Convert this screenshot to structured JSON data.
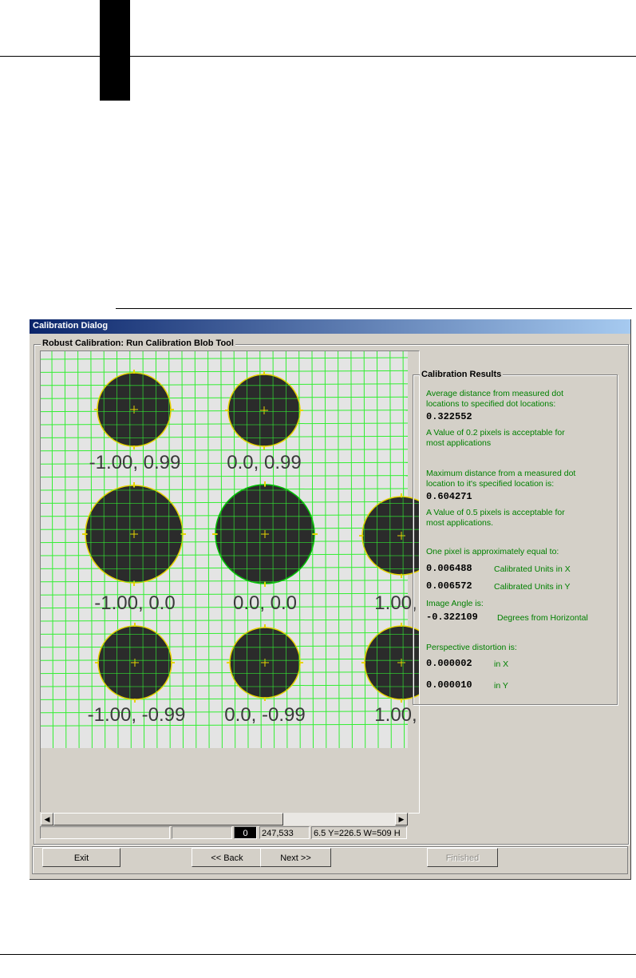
{
  "dialog": {
    "title": "Calibration Dialog",
    "group_title": "Robust Calibration: Run Calibration Blob Tool"
  },
  "image_view": {
    "dots": [
      {
        "label": "-1.00, 0.99"
      },
      {
        "label": "0.0, 0.99"
      },
      {
        "label": "-1.00, 0.0"
      },
      {
        "label": "0.0, 0.0"
      },
      {
        "label": "1.00,"
      },
      {
        "label": "-1.00, -0.99"
      },
      {
        "label": "0.0, -0.99"
      },
      {
        "label": "1.00,"
      }
    ],
    "colors": {
      "dot": "#2b2b2b",
      "grid": "#33ee33",
      "outline": "#e6d400",
      "background": "#e4e4e4",
      "center_dot": "#00c000"
    }
  },
  "statusbar": {
    "value": "0",
    "coords": "247,533",
    "roi": "6.5 Y=226.5 W=509 H"
  },
  "results": {
    "title": "Calibration Results",
    "avg_label": "Average distance from measured dot locations to specified dot locations:",
    "avg_line1": "Average distance from measured dot",
    "avg_line2": "locations to specified dot locations:",
    "avg_value": "0.322552",
    "avg_note1": "A Value of 0.2 pixels is acceptable for",
    "avg_note2": "most applications",
    "max_line1": "Maximum distance from a measured dot",
    "max_line2": "location to it's specified location is:",
    "max_value": "0.604271",
    "max_note1": "A Value of 0.5 pixels is acceptable for",
    "max_note2": "most applications.",
    "pixel_label": "One pixel is approximately equal to:",
    "x_value": "0.006488",
    "x_unit": "Calibrated Units in X",
    "y_value": "0.006572",
    "y_unit": "Calibrated Units in Y",
    "angle_label": "Image Angle is:",
    "angle_value": "-0.322109",
    "angle_unit": "Degrees from Horizontal",
    "persp_label": "Perspective distortion is:",
    "px_value": "0.000002",
    "px_unit": "in X",
    "py_value": "0.000010",
    "py_unit": "in Y"
  },
  "buttons": {
    "exit": "Exit",
    "back": "<< Back",
    "next": "Next >>",
    "finished": "Finished"
  }
}
